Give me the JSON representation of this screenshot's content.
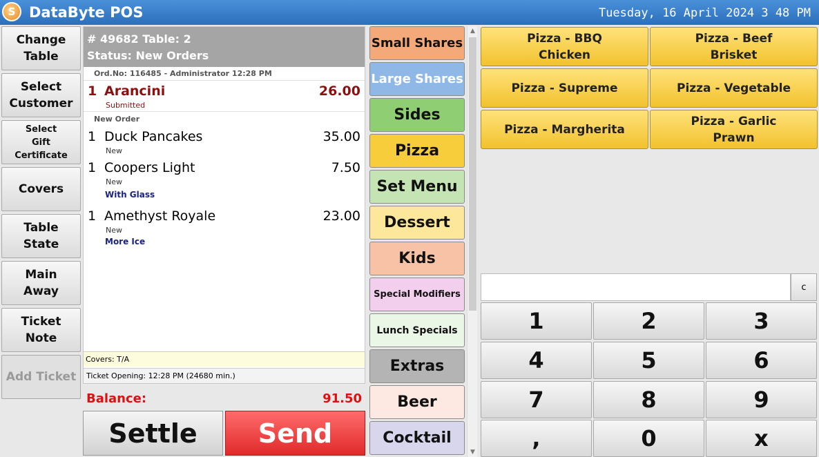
{
  "app": {
    "title": "DataByte POS",
    "logo_glyph": "S",
    "datetime": "Tuesday, 16 April 2024 3 48 PM"
  },
  "left_buttons": [
    {
      "label": "Change\nTable",
      "disabled": false
    },
    {
      "label": "Select\nCustomer",
      "disabled": false
    },
    {
      "label": "Select\nGift\nCertificate",
      "disabled": false
    },
    {
      "label": "Covers",
      "disabled": false
    },
    {
      "label": "Table\nState",
      "disabled": false
    },
    {
      "label": "Main\nAway",
      "disabled": false
    },
    {
      "label": "Ticket\nNote",
      "disabled": false
    },
    {
      "label": "Add Ticket",
      "disabled": true
    }
  ],
  "ticket": {
    "header_line1": "# 49682 Table: 2",
    "header_line2": "Status: New Orders",
    "order_info": "Ord.No: 116485 - Administrator  12:28 PM",
    "sent_items": [
      {
        "qty": "1",
        "name": "Arancini",
        "price": "26.00",
        "status": "Submitted"
      }
    ],
    "new_order_label": "New Order",
    "new_items": [
      {
        "qty": "1",
        "name": "Duck Pancakes",
        "price": "35.00",
        "status": "New",
        "modifier": ""
      },
      {
        "qty": "1",
        "name": "Coopers Light",
        "price": "7.50",
        "status": "New",
        "modifier": "With Glass"
      },
      {
        "qty": "1",
        "name": "Amethyst Royale",
        "price": "23.00",
        "status": "New",
        "modifier": "More Ice"
      }
    ],
    "covers": "Covers: T/A",
    "opening": "Ticket Opening:    12:28 PM (24680 min.)"
  },
  "balance": {
    "label": "Balance:",
    "value": "91.50"
  },
  "actions": {
    "settle": "Settle",
    "send": "Send"
  },
  "categories": [
    {
      "label": "Small Shares",
      "color": "#f3a97a",
      "text_color": "#111111"
    },
    {
      "label": "Large Shares",
      "color": "#8fb8e6",
      "text_color": "#ffffff"
    },
    {
      "label": "Sides",
      "color": "#8fce72",
      "text_color": "#111111"
    },
    {
      "label": "Pizza",
      "color": "#f7cd3c",
      "text_color": "#111111"
    },
    {
      "label": "Set Menu",
      "color": "#c4e4b4",
      "text_color": "#111111"
    },
    {
      "label": "Dessert",
      "color": "#fde79a",
      "text_color": "#111111"
    },
    {
      "label": "Kids",
      "color": "#f7c2a5",
      "text_color": "#111111"
    },
    {
      "label": "Special Modifiers",
      "color": "#f3cfee",
      "text_color": "#111111"
    },
    {
      "label": "Lunch Specials",
      "color": "#eaf6e6",
      "text_color": "#111111"
    },
    {
      "label": "Extras",
      "color": "#b4b4b4",
      "text_color": "#111111"
    },
    {
      "label": "Beer",
      "color": "#fde9e1",
      "text_color": "#111111"
    },
    {
      "label": "Cocktail",
      "color": "#d8d6ec",
      "text_color": "#111111"
    }
  ],
  "products": [
    "Pizza - BBQ\nChicken",
    "Pizza - Beef\nBrisket",
    "Pizza - Supreme",
    "Pizza - Vegetable",
    "Pizza - Margherita",
    "Pizza - Garlic\nPrawn"
  ],
  "numpad": {
    "clear_label": "c",
    "keys": [
      "1",
      "2",
      "3",
      "4",
      "5",
      "6",
      "7",
      "8",
      "9",
      ",",
      "0",
      "x"
    ]
  },
  "scroll": {
    "up": "▲",
    "down": "▼"
  }
}
